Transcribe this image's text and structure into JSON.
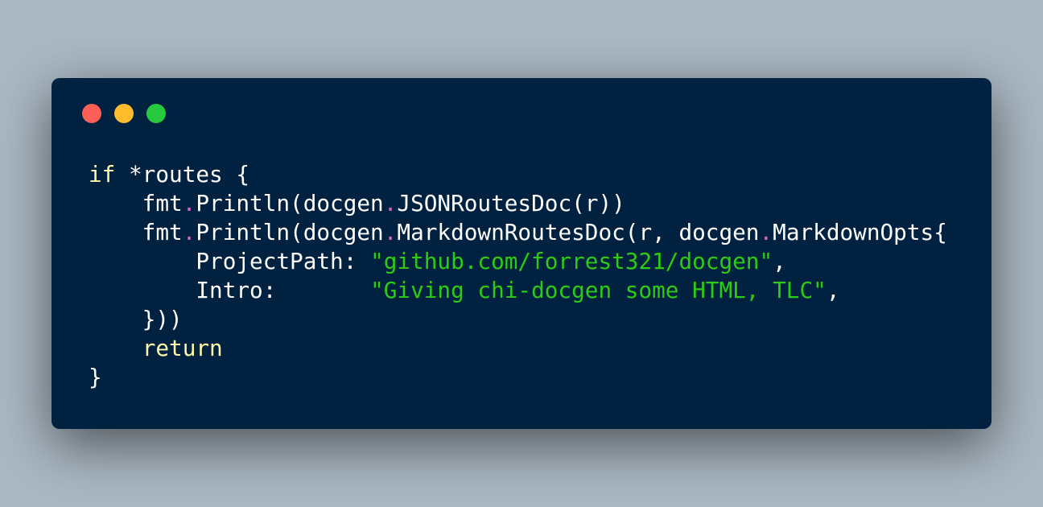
{
  "window_controls": {
    "close_color": "#ff5f56",
    "minimize_color": "#ffbd2e",
    "maximize_color": "#27c93f"
  },
  "colors": {
    "background": "#abb8c3",
    "editor_background": "#002140",
    "default": "#ffffff",
    "keyword": "#fffba8",
    "string": "#2dcb15",
    "operator": "#c865c8"
  },
  "code_lines": [
    [
      {
        "text": "if",
        "type": "keyword"
      },
      {
        "text": " *routes {",
        "type": "default"
      }
    ],
    [
      {
        "text": "    fmt",
        "type": "default"
      },
      {
        "text": ".",
        "type": "operator"
      },
      {
        "text": "Println(docgen",
        "type": "default"
      },
      {
        "text": ".",
        "type": "operator"
      },
      {
        "text": "JSONRoutesDoc(r))",
        "type": "default"
      }
    ],
    [
      {
        "text": "    fmt",
        "type": "default"
      },
      {
        "text": ".",
        "type": "operator"
      },
      {
        "text": "Println(docgen",
        "type": "default"
      },
      {
        "text": ".",
        "type": "operator"
      },
      {
        "text": "MarkdownRoutesDoc(r, docgen",
        "type": "default"
      },
      {
        "text": ".",
        "type": "operator"
      },
      {
        "text": "MarkdownOpts{",
        "type": "default"
      }
    ],
    [
      {
        "text": "        ProjectPath: ",
        "type": "default"
      },
      {
        "text": "\"github.com/forrest321/docgen\"",
        "type": "string"
      },
      {
        "text": ",",
        "type": "default"
      }
    ],
    [
      {
        "text": "        Intro:       ",
        "type": "default"
      },
      {
        "text": "\"Giving chi-docgen some HTML, TLC\"",
        "type": "string"
      },
      {
        "text": ",",
        "type": "default"
      }
    ],
    [
      {
        "text": "    }))",
        "type": "default"
      }
    ],
    [
      {
        "text": "    ",
        "type": "default"
      },
      {
        "text": "return",
        "type": "keyword"
      }
    ],
    [
      {
        "text": "}",
        "type": "default"
      }
    ]
  ]
}
